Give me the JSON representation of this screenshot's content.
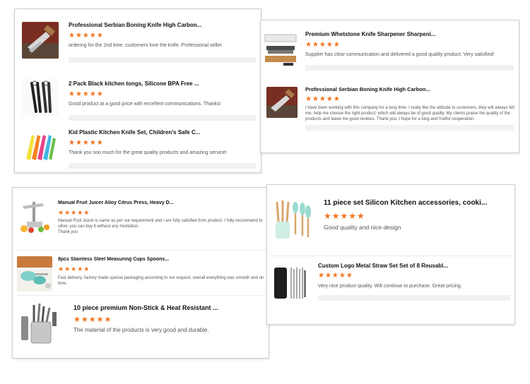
{
  "rating_symbol": "★★★★★",
  "colors": {
    "star": "#f0741e",
    "border": "#cfcfcf"
  },
  "card1": {
    "items": [
      {
        "icon": "boning-knife-image",
        "title": "Professional Serbian Boning Knife High Carbon...",
        "review": "ordering for the 2nd time. customers love the knife. Professional seller."
      },
      {
        "icon": "black-tongs-image",
        "title": "2 Pack Black kitchen tongs, Silicone BPA Free ...",
        "review": "Good product at a good price with excellent communications. Thanks!"
      },
      {
        "icon": "kid-knife-set-image",
        "title": "Kid Plastic Kitchen Knife Set, Children's Safe C...",
        "review": "Thank you soo much for the great quality products and amazing service!"
      }
    ]
  },
  "card2": {
    "items": [
      {
        "icon": "whetstone-sharpener-image",
        "title": "Premium Whetstone Knife Sharpener Sharpeni...",
        "review": "Supplier has clear communication and delivered a good quality product. Very satisfied!"
      },
      {
        "icon": "boning-knife-image",
        "title": "Professional Serbian Boning Knife High Carbon...",
        "review": "I have been working with this company for a long time. I really like the attitude to customers, they will always tell me, help me choose the right product, which will always be of good quality. My clients praise the quality of the products and leave me good reviews. Thank you, I hope for a long and fruitful cooperation."
      }
    ]
  },
  "card3": {
    "items": [
      {
        "icon": "fruit-juicer-image",
        "title": "Manual Fruit Juicer Alloy Citrus Press, Heavy D...",
        "review": "Manual Fruit Juicer is same as per our requirement and I am fully satisfied from product. I fully recommend to other, you can buy it without any hesitation.\nThank you"
      },
      {
        "icon": "measuring-cups-image",
        "title": "8pcs Stainless Steel Measuring Cups Spoons...",
        "review": "Fast delivery. factory made special packaging according to our request. overall everything was smooth and on time."
      },
      {
        "icon": "utensil-set-image",
        "title": "10 piece premium Non-Stick & Heat Resistant ...",
        "review": "The material of the products is very good and durable."
      }
    ]
  },
  "card4": {
    "items": [
      {
        "icon": "silicone-utensils-image",
        "title": "11 piece set Silicon Kitchen accessories, cooki...",
        "review": "Good quality and nice design"
      },
      {
        "icon": "metal-straw-set-image",
        "title": "Custom Logo Metal Straw Set Set of 8 Reusabl...",
        "review": "Very nice product quality.  Will continue to purchase.  Great pricing."
      }
    ]
  }
}
